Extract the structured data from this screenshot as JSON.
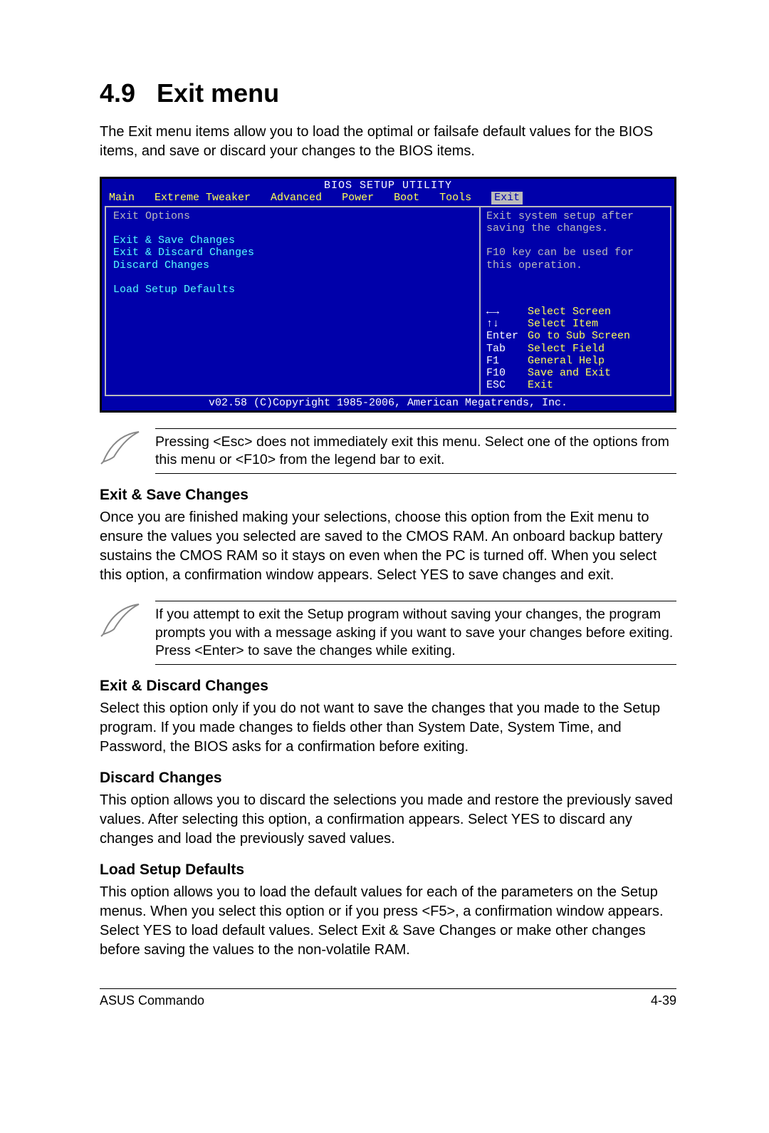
{
  "heading": {
    "number": "4.9",
    "title": "Exit menu"
  },
  "intro": "The Exit menu items allow you to load the optimal or failsafe default values for the BIOS items, and save or discard your changes to the BIOS items.",
  "bios": {
    "title": "BIOS SETUP UTILITY",
    "tabs": [
      "Main",
      "Extreme Tweaker",
      "Advanced",
      "Power",
      "Boot",
      "Tools",
      "Exit"
    ],
    "selected_tab": "Exit",
    "section_label": "Exit Options",
    "items": [
      "Exit & Save Changes",
      "Exit & Discard Changes",
      "Discard Changes",
      "",
      "Load Setup Defaults"
    ],
    "help_text": "Exit system setup after saving the changes.\n\nF10 key can be used for this operation.",
    "nav": [
      {
        "key": "←→",
        "label": "Select Screen"
      },
      {
        "key": "↑↓",
        "label": "Select Item"
      },
      {
        "key": "Enter",
        "label": "Go to Sub Screen"
      },
      {
        "key": "Tab",
        "label": "Select Field"
      },
      {
        "key": "F1",
        "label": "General Help"
      },
      {
        "key": "F10",
        "label": "Save and Exit"
      },
      {
        "key": "ESC",
        "label": "Exit"
      }
    ],
    "footer": "v02.58 (C)Copyright 1985-2006, American Megatrends, Inc."
  },
  "note1": "Pressing <Esc> does not immediately exit this menu. Select one of the options from this menu or <F10> from the legend bar to exit.",
  "sections": [
    {
      "title": "Exit & Save Changes",
      "text": "Once you are finished making your selections, choose this option from the Exit menu to ensure the values you selected are saved to the CMOS RAM. An onboard backup battery sustains the CMOS RAM so it stays on even when the PC is turned off. When you select this option, a confirmation window appears. Select YES to save changes and exit."
    },
    {
      "title": "Exit & Discard Changes",
      "text": "Select this option only if you do not want to save the changes that you  made to the Setup program. If you made changes to fields other than System Date, System Time, and Password, the BIOS asks for a confirmation before exiting."
    },
    {
      "title": "Discard Changes",
      "text": "This option allows you to discard the selections you made and restore the previously saved values. After selecting this option, a confirmation appears. Select YES to discard any changes and load the previously saved values."
    },
    {
      "title": "Load Setup Defaults",
      "text": "This option allows you to load the default values for each of the parameters on the Setup menus. When you select this option or if you press <F5>, a confirmation window appears. Select YES to load default values. Select Exit & Save Changes or make other changes before saving the values to the non-volatile RAM."
    }
  ],
  "note2": "If you attempt to exit the Setup program without saving your changes, the program prompts you with a message asking if you want to save your changes before exiting. Press <Enter>  to save the  changes while exiting.",
  "footer": {
    "left": "ASUS Commando",
    "right": "4-39"
  }
}
